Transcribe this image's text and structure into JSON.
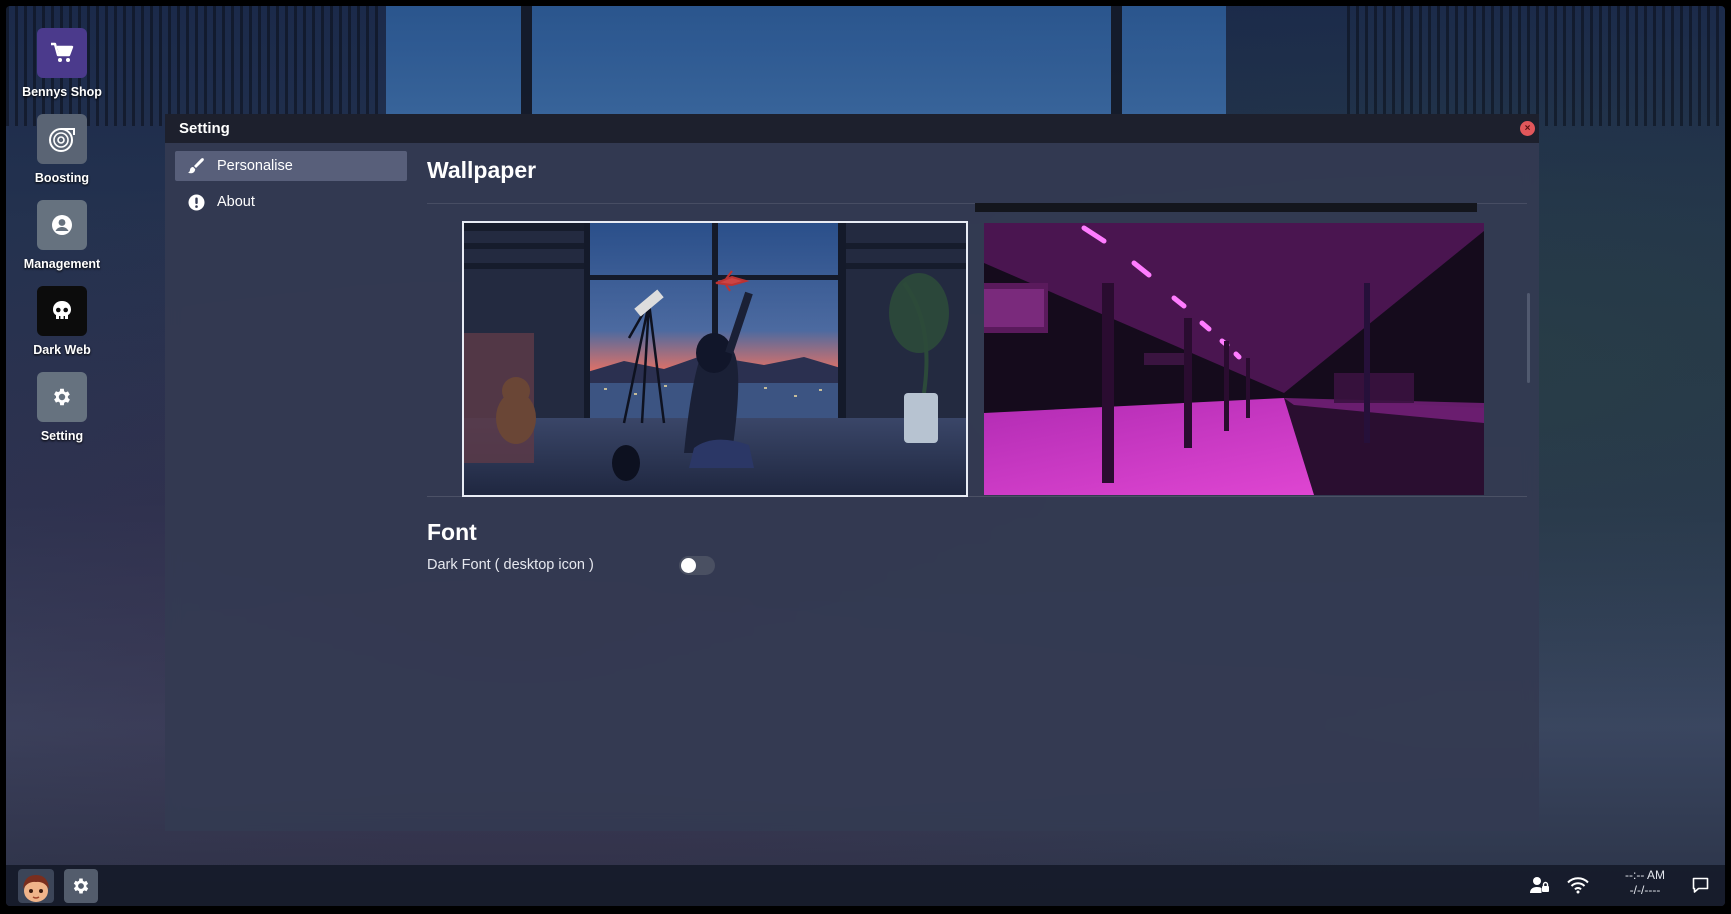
{
  "desktop": {
    "icons": [
      {
        "label": "Bennys Shop",
        "icon": "cart-icon"
      },
      {
        "label": "Boosting",
        "icon": "turbo-icon"
      },
      {
        "label": "Management",
        "icon": "user-circle-icon"
      },
      {
        "label": "Dark Web",
        "icon": "skull-icon"
      },
      {
        "label": "Setting",
        "icon": "gear-icon"
      }
    ]
  },
  "window": {
    "title": "Setting",
    "close_icon": "close-icon",
    "sidebar": [
      {
        "label": "Personalise",
        "icon": "brush-icon",
        "active": true
      },
      {
        "label": "About",
        "icon": "info-icon",
        "active": false
      }
    ],
    "wallpaper": {
      "heading": "Wallpaper",
      "selected_index": 0
    },
    "font": {
      "heading": "Font",
      "dark_font_label": "Dark Font ( desktop icon )",
      "dark_font_enabled": false
    }
  },
  "taskbar": {
    "clock_time": "--:-- AM",
    "clock_date": "-/-/----",
    "icons": [
      "avatar",
      "gear-icon",
      "user-lock-icon",
      "wifi-icon",
      "chat-icon"
    ]
  },
  "colors": {
    "accent_shop": "#4b3a8c",
    "close_red": "#e2575b",
    "window_bg": "#343a52",
    "neon_pink": "#d62fd6"
  }
}
